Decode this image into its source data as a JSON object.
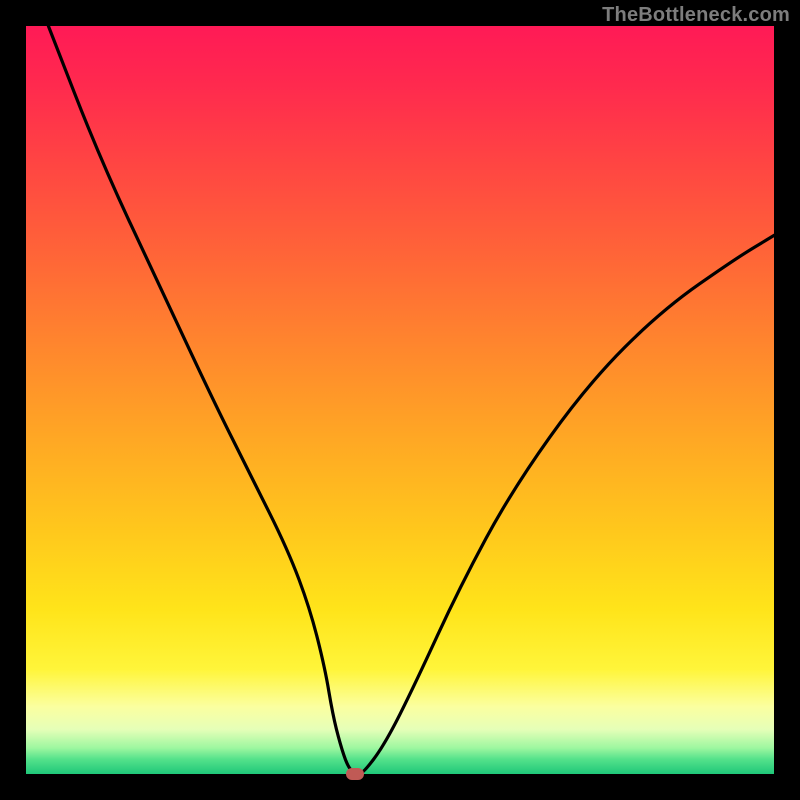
{
  "watermark": "TheBottleneck.com",
  "colors": {
    "frame": "#000000",
    "curve": "#000000",
    "marker": "#c05a55"
  },
  "chart_data": {
    "type": "line",
    "title": "",
    "xlabel": "",
    "ylabel": "",
    "xlim": [
      0,
      100
    ],
    "ylim": [
      0,
      100
    ],
    "grid": false,
    "legend": false,
    "series": [
      {
        "name": "bottleneck-curve",
        "x": [
          3,
          10,
          18,
          25,
          30,
          35,
          38,
          40,
          41,
          42,
          43,
          44,
          45,
          48,
          52,
          58,
          65,
          75,
          85,
          95,
          100
        ],
        "values": [
          100,
          82,
          65,
          50,
          40,
          30,
          22,
          14,
          8,
          4,
          1,
          0,
          0,
          4,
          12,
          25,
          38,
          52,
          62,
          69,
          72
        ]
      }
    ],
    "marker": {
      "x": 44,
      "y": 0
    },
    "background_gradient_meaning": "red=high bottleneck, green=low bottleneck"
  }
}
